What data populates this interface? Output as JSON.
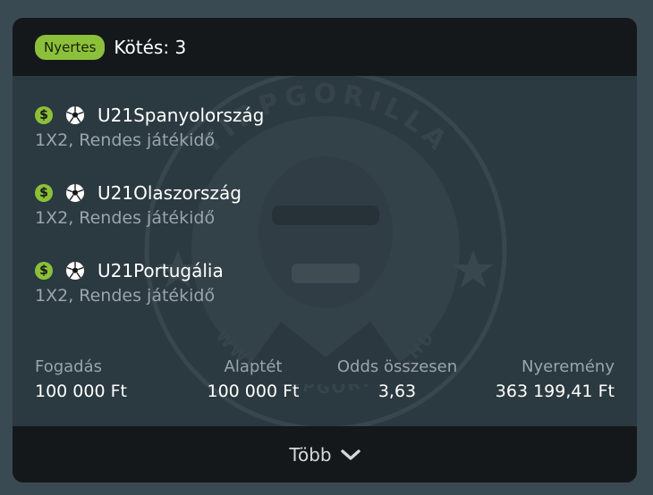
{
  "header": {
    "badge": "Nyertes",
    "title": "Kötés: 3"
  },
  "watermark": {
    "text_top": "TIPPGORILLA",
    "text_bottom": "WWW.TIPPGORILLA.HU"
  },
  "selections": [
    {
      "team": "U21Spanyolország",
      "market": "1X2, Rendes játékidő",
      "icon_pay": "dollar-icon",
      "icon_sport": "soccer-ball-icon"
    },
    {
      "team": "U21Olaszország",
      "market": "1X2, Rendes játékidő",
      "icon_pay": "dollar-icon",
      "icon_sport": "soccer-ball-icon"
    },
    {
      "team": "U21Portugália",
      "market": "1X2, Rendes játékidő",
      "icon_pay": "dollar-icon",
      "icon_sport": "soccer-ball-icon"
    }
  ],
  "stats": {
    "stake": {
      "label": "Fogadás",
      "value": "100 000 Ft"
    },
    "base": {
      "label": "Alaptét",
      "value": "100 000 Ft"
    },
    "odds": {
      "label": "Odds összesen",
      "value": "3,63"
    },
    "winnings": {
      "label": "Nyeremény",
      "value": "363 199,41 Ft"
    }
  },
  "footer": {
    "label": "Több",
    "icon": "chevron-down-icon"
  },
  "colors": {
    "accent": "#8cc03a",
    "card": "#2b3940",
    "header": "#15181b",
    "page": "#3a4a52"
  }
}
